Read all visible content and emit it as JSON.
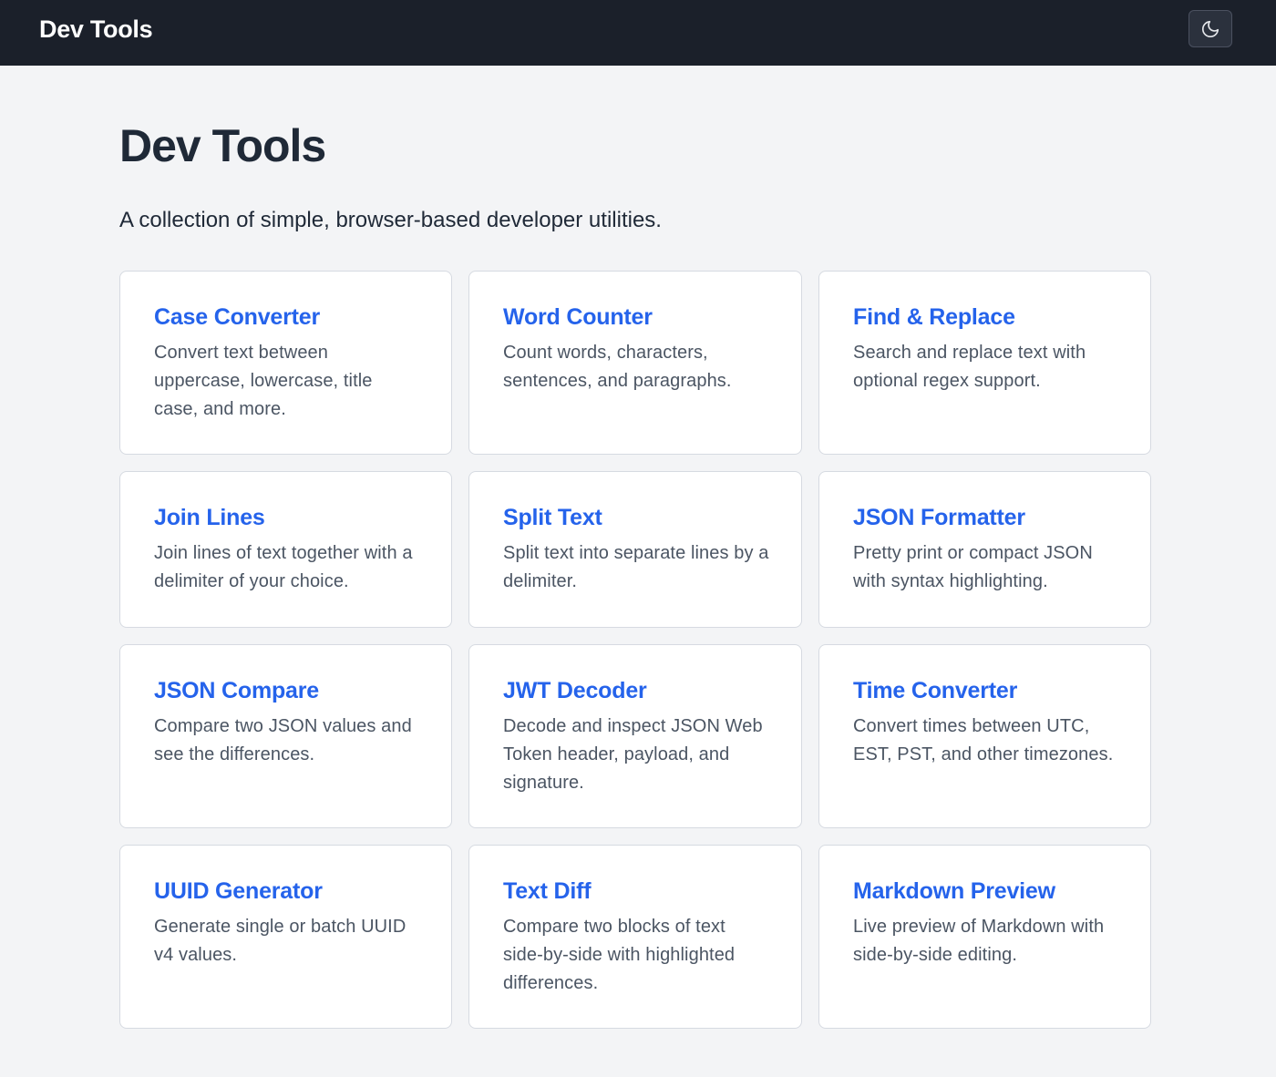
{
  "header": {
    "brand": "Dev Tools",
    "theme_toggle_icon": "moon-icon"
  },
  "main": {
    "title": "Dev Tools",
    "subtitle": "A collection of simple, browser-based developer utilities."
  },
  "tools": [
    {
      "title": "Case Converter",
      "description": "Convert text between uppercase, lowercase, title case, and more."
    },
    {
      "title": "Word Counter",
      "description": "Count words, characters, sentences, and paragraphs."
    },
    {
      "title": "Find & Replace",
      "description": "Search and replace text with optional regex support."
    },
    {
      "title": "Join Lines",
      "description": "Join lines of text together with a delimiter of your choice."
    },
    {
      "title": "Split Text",
      "description": "Split text into separate lines by a delimiter."
    },
    {
      "title": "JSON Formatter",
      "description": "Pretty print or compact JSON with syntax highlighting."
    },
    {
      "title": "JSON Compare",
      "description": "Compare two JSON values and see the differences."
    },
    {
      "title": "JWT Decoder",
      "description": "Decode and inspect JSON Web Token header, payload, and signature."
    },
    {
      "title": "Time Converter",
      "description": "Convert times between UTC, EST, PST, and other timezones."
    },
    {
      "title": "UUID Generator",
      "description": "Generate single or batch UUID v4 values."
    },
    {
      "title": "Text Diff",
      "description": "Compare two blocks of text side-by-side with highlighted differences."
    },
    {
      "title": "Markdown Preview",
      "description": "Live preview of Markdown with side-by-side editing."
    }
  ],
  "colors": {
    "header_bg": "#1b202a",
    "page_bg": "#f3f4f6",
    "link": "#2563eb",
    "card_border": "#d6dae1",
    "muted_text": "#4b5563"
  }
}
